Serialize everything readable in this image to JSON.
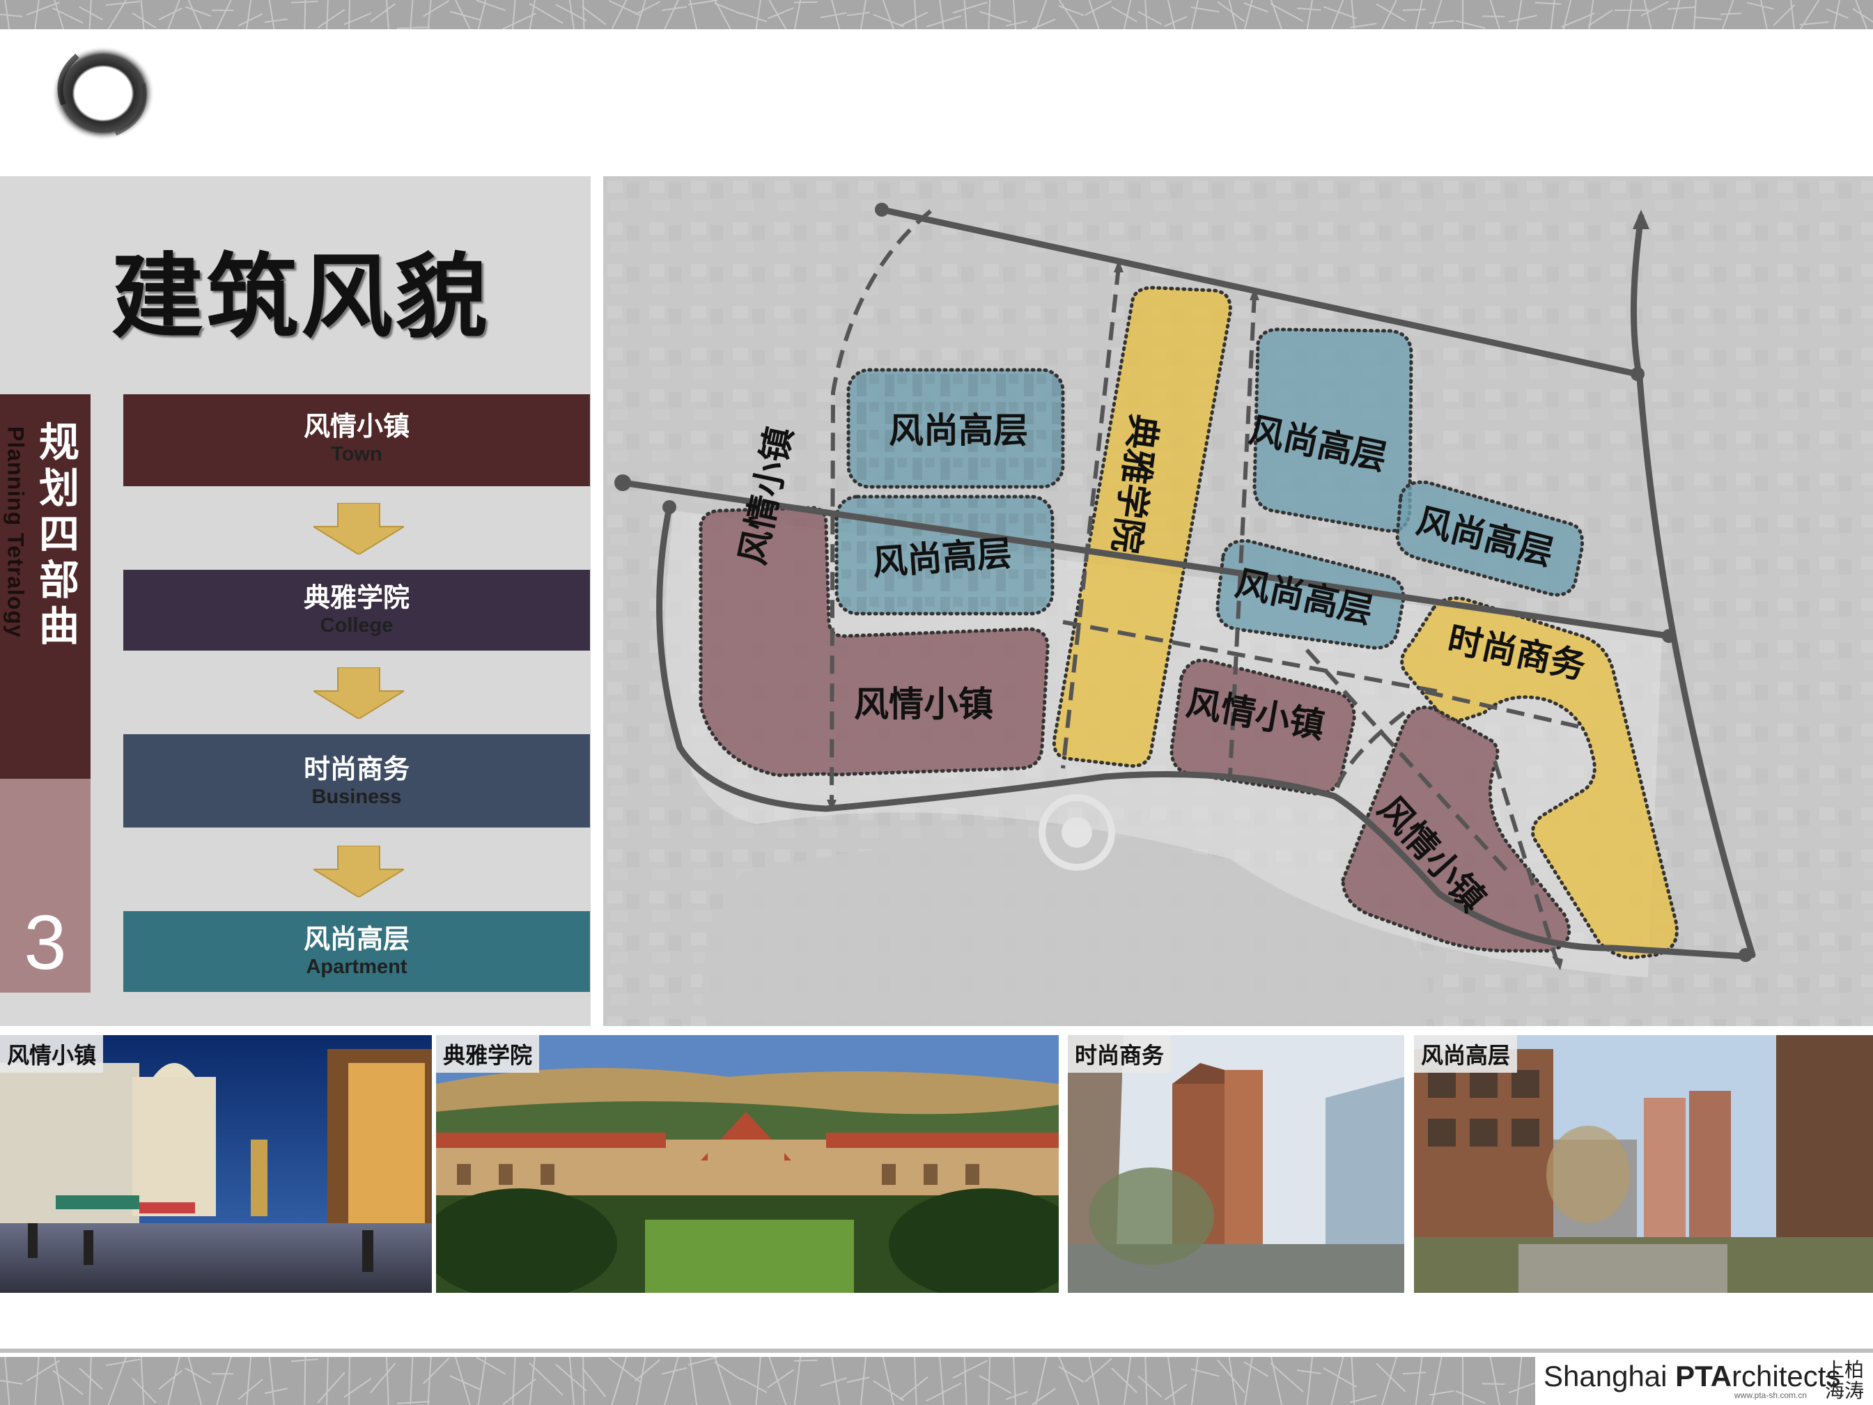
{
  "page": {
    "title": "建筑风貌",
    "side_title_cn": "规划四部曲",
    "side_title_en": "Planning Tetralogy",
    "section_number": "3"
  },
  "phases": [
    {
      "cn": "风情小镇",
      "en": "Town",
      "color": "#512829"
    },
    {
      "cn": "典雅学院",
      "en": "College",
      "color": "#3a2f44"
    },
    {
      "cn": "时尚商务",
      "en": "Business",
      "color": "#3e4c64"
    },
    {
      "cn": "风尚高层",
      "en": "Apartment",
      "color": "#357280"
    }
  ],
  "map_labels": {
    "apartment": "风尚高层",
    "college": "典雅学院",
    "business": "时尚商务",
    "town": "风情小镇"
  },
  "zone_colors": {
    "apartment": "#6f9fb0",
    "college": "#e6c14c",
    "business": "#e6c14c",
    "town": "#8a5e66"
  },
  "photos": [
    {
      "label": "风情小镇",
      "icon": "european-town-photo"
    },
    {
      "label": "典雅学院",
      "icon": "college-campus-photo"
    },
    {
      "label": "时尚商务",
      "icon": "business-tower-photo"
    },
    {
      "label": "风尚高层",
      "icon": "apartment-street-photo"
    }
  ],
  "logo": {
    "text_plain": "Shanghai ",
    "text_bold": "PTA",
    "text_rest": "rchitects",
    "cn": "上柏海涛",
    "url": "www.pta-sh.com.cn"
  }
}
